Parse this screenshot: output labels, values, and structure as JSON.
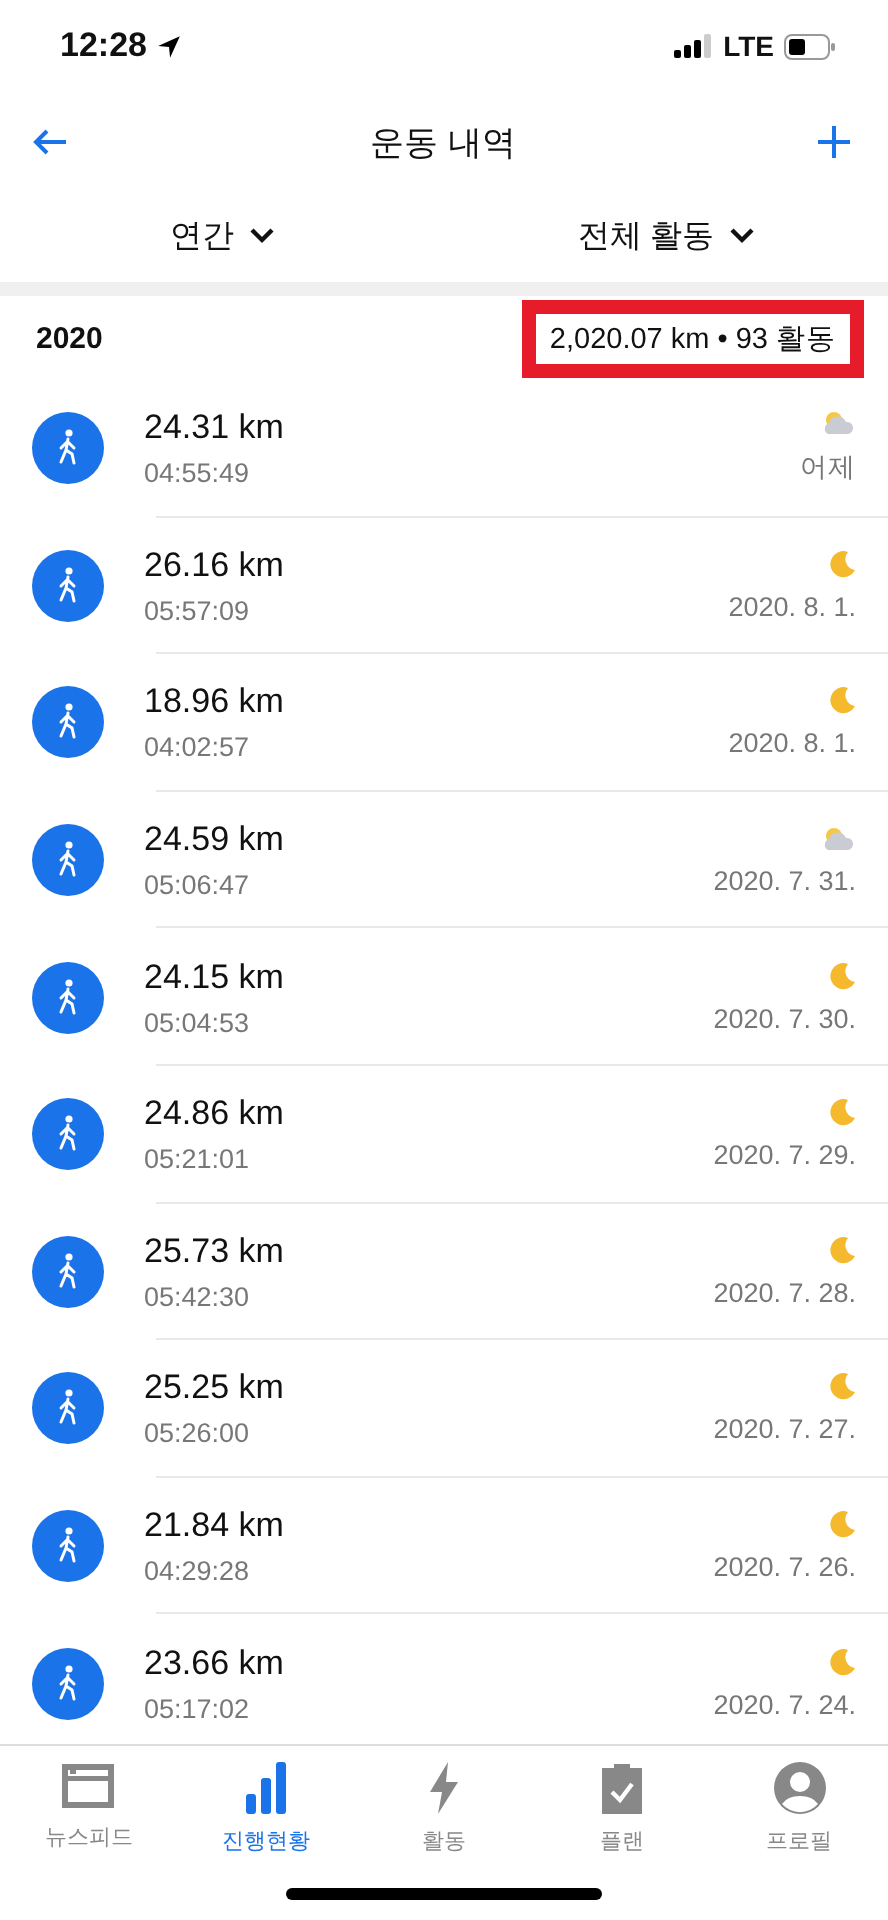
{
  "status_bar": {
    "time": "12:28",
    "network": "LTE"
  },
  "nav": {
    "title": "운동 내역"
  },
  "filters": [
    {
      "label": "연간"
    },
    {
      "label": "전체 활동"
    }
  ],
  "section": {
    "year": "2020",
    "summary": "2,020.07 km • 93 활동",
    "highlighted": true
  },
  "activities": [
    {
      "distance": "24.31 km",
      "duration": "04:55:49",
      "date": "어제",
      "kind": "cloud"
    },
    {
      "distance": "26.16 km",
      "duration": "05:57:09",
      "date": "2020. 8. 1.",
      "kind": "moon"
    },
    {
      "distance": "18.96 km",
      "duration": "04:02:57",
      "date": "2020. 8. 1.",
      "kind": "moon"
    },
    {
      "distance": "24.59 km",
      "duration": "05:06:47",
      "date": "2020. 7. 31.",
      "kind": "cloud"
    },
    {
      "distance": "24.15 km",
      "duration": "05:04:53",
      "date": "2020. 7. 30.",
      "kind": "moon"
    },
    {
      "distance": "24.86 km",
      "duration": "05:21:01",
      "date": "2020. 7. 29.",
      "kind": "moon"
    },
    {
      "distance": "25.73 km",
      "duration": "05:42:30",
      "date": "2020. 7. 28.",
      "kind": "moon"
    },
    {
      "distance": "25.25 km",
      "duration": "05:26:00",
      "date": "2020. 7. 27.",
      "kind": "moon"
    },
    {
      "distance": "21.84 km",
      "duration": "04:29:28",
      "date": "2020. 7. 26.",
      "kind": "moon"
    },
    {
      "distance": "23.66 km",
      "duration": "05:17:02",
      "date": "2020. 7. 24.",
      "kind": "moon"
    }
  ],
  "tab_bar": [
    {
      "label": "뉴스피드",
      "kind": "feed",
      "selected": false
    },
    {
      "label": "진행현황",
      "kind": "bars",
      "selected": true
    },
    {
      "label": "활동",
      "kind": "bolt",
      "selected": false
    },
    {
      "label": "플랜",
      "kind": "clipboard",
      "selected": false
    },
    {
      "label": "프로필",
      "kind": "person",
      "selected": false
    }
  ]
}
